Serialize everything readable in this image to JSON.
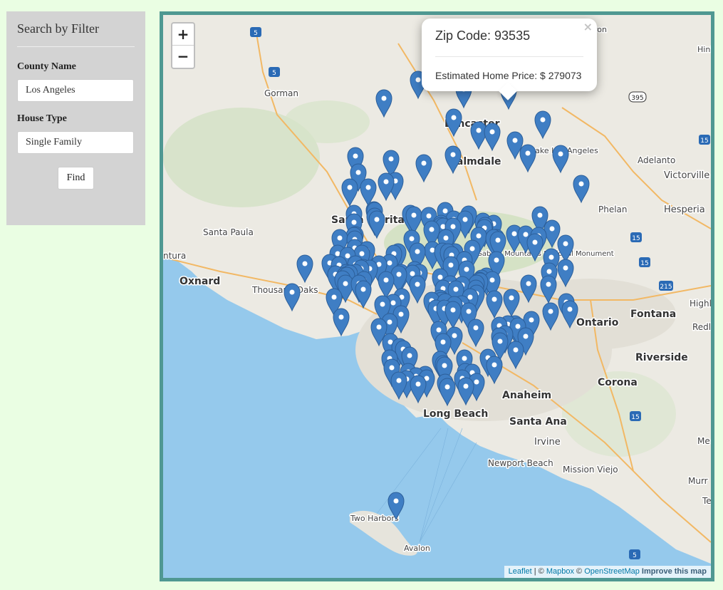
{
  "sidebar": {
    "title": "Search by Filter",
    "county_label": "County Name",
    "county_value": "Los Angeles",
    "house_label": "House Type",
    "house_value": "Single Family",
    "find_label": "Find"
  },
  "map": {
    "zoom_in": "+",
    "zoom_out": "−",
    "popup": {
      "close": "×",
      "zip_line": "Zip Code: 93535",
      "price_line": "Estimated Home Price: $ 279073"
    },
    "attribution": {
      "leaflet": "Leaflet",
      "sep": " | © ",
      "mapbox": "Mapbox",
      "sep2": " © ",
      "osm": "OpenStreetMap",
      "improve": "Improve this map"
    },
    "places": [
      {
        "id": "gorman",
        "text": "Gorman"
      },
      {
        "id": "lancaster",
        "text": "Lancaster"
      },
      {
        "id": "palmdale",
        "text": "Palmdale"
      },
      {
        "id": "lake-los-angeles",
        "text": "Lake Los Angeles"
      },
      {
        "id": "adelanto",
        "text": "Adelanto"
      },
      {
        "id": "victorville",
        "text": "Victorville"
      },
      {
        "id": "hinkley",
        "text": "Hink"
      },
      {
        "id": "hesperia",
        "text": "Hesperia"
      },
      {
        "id": "phelan",
        "text": "Phelan"
      },
      {
        "id": "santa-clarita",
        "text": "Santa Clarita"
      },
      {
        "id": "santa-paula",
        "text": "Santa Paula"
      },
      {
        "id": "ventura",
        "text": "ntura"
      },
      {
        "id": "oxnard",
        "text": "Oxnard"
      },
      {
        "id": "thousand-oaks",
        "text": "Thousand Oaks"
      },
      {
        "id": "san-gabriel",
        "text": "San Gabriel Mountains National Monument"
      },
      {
        "id": "fontana",
        "text": "Fontana"
      },
      {
        "id": "ontario",
        "text": "Ontario"
      },
      {
        "id": "riverside",
        "text": "Riverside"
      },
      {
        "id": "corona",
        "text": "Corona"
      },
      {
        "id": "anaheim",
        "text": "Anaheim"
      },
      {
        "id": "long-beach",
        "text": "Long Beach"
      },
      {
        "id": "santa-ana",
        "text": "Santa Ana"
      },
      {
        "id": "irvine",
        "text": "Irvine"
      },
      {
        "id": "newport-beach",
        "text": "Newport Beach"
      },
      {
        "id": "mission-viejo",
        "text": "Mission Viejo"
      },
      {
        "id": "two-harbors",
        "text": "Two Harbors"
      },
      {
        "id": "avalon",
        "text": "Avalon"
      },
      {
        "id": "highland",
        "text": "Highl"
      },
      {
        "id": "redlands",
        "text": "Redl"
      },
      {
        "id": "menifee",
        "text": "Me"
      },
      {
        "id": "murrieta",
        "text": "Murr"
      },
      {
        "id": "temecula",
        "text": "Te"
      },
      {
        "id": "barstow",
        "text": "ron"
      }
    ],
    "shields": [
      "5",
      "5",
      "395",
      "15",
      "15",
      "15",
      "215",
      "15",
      "5"
    ],
    "colors": {
      "border": "#4f9892",
      "marker": "#3f7ec4",
      "water": "#95c9ec",
      "land": "#eceae3"
    }
  }
}
